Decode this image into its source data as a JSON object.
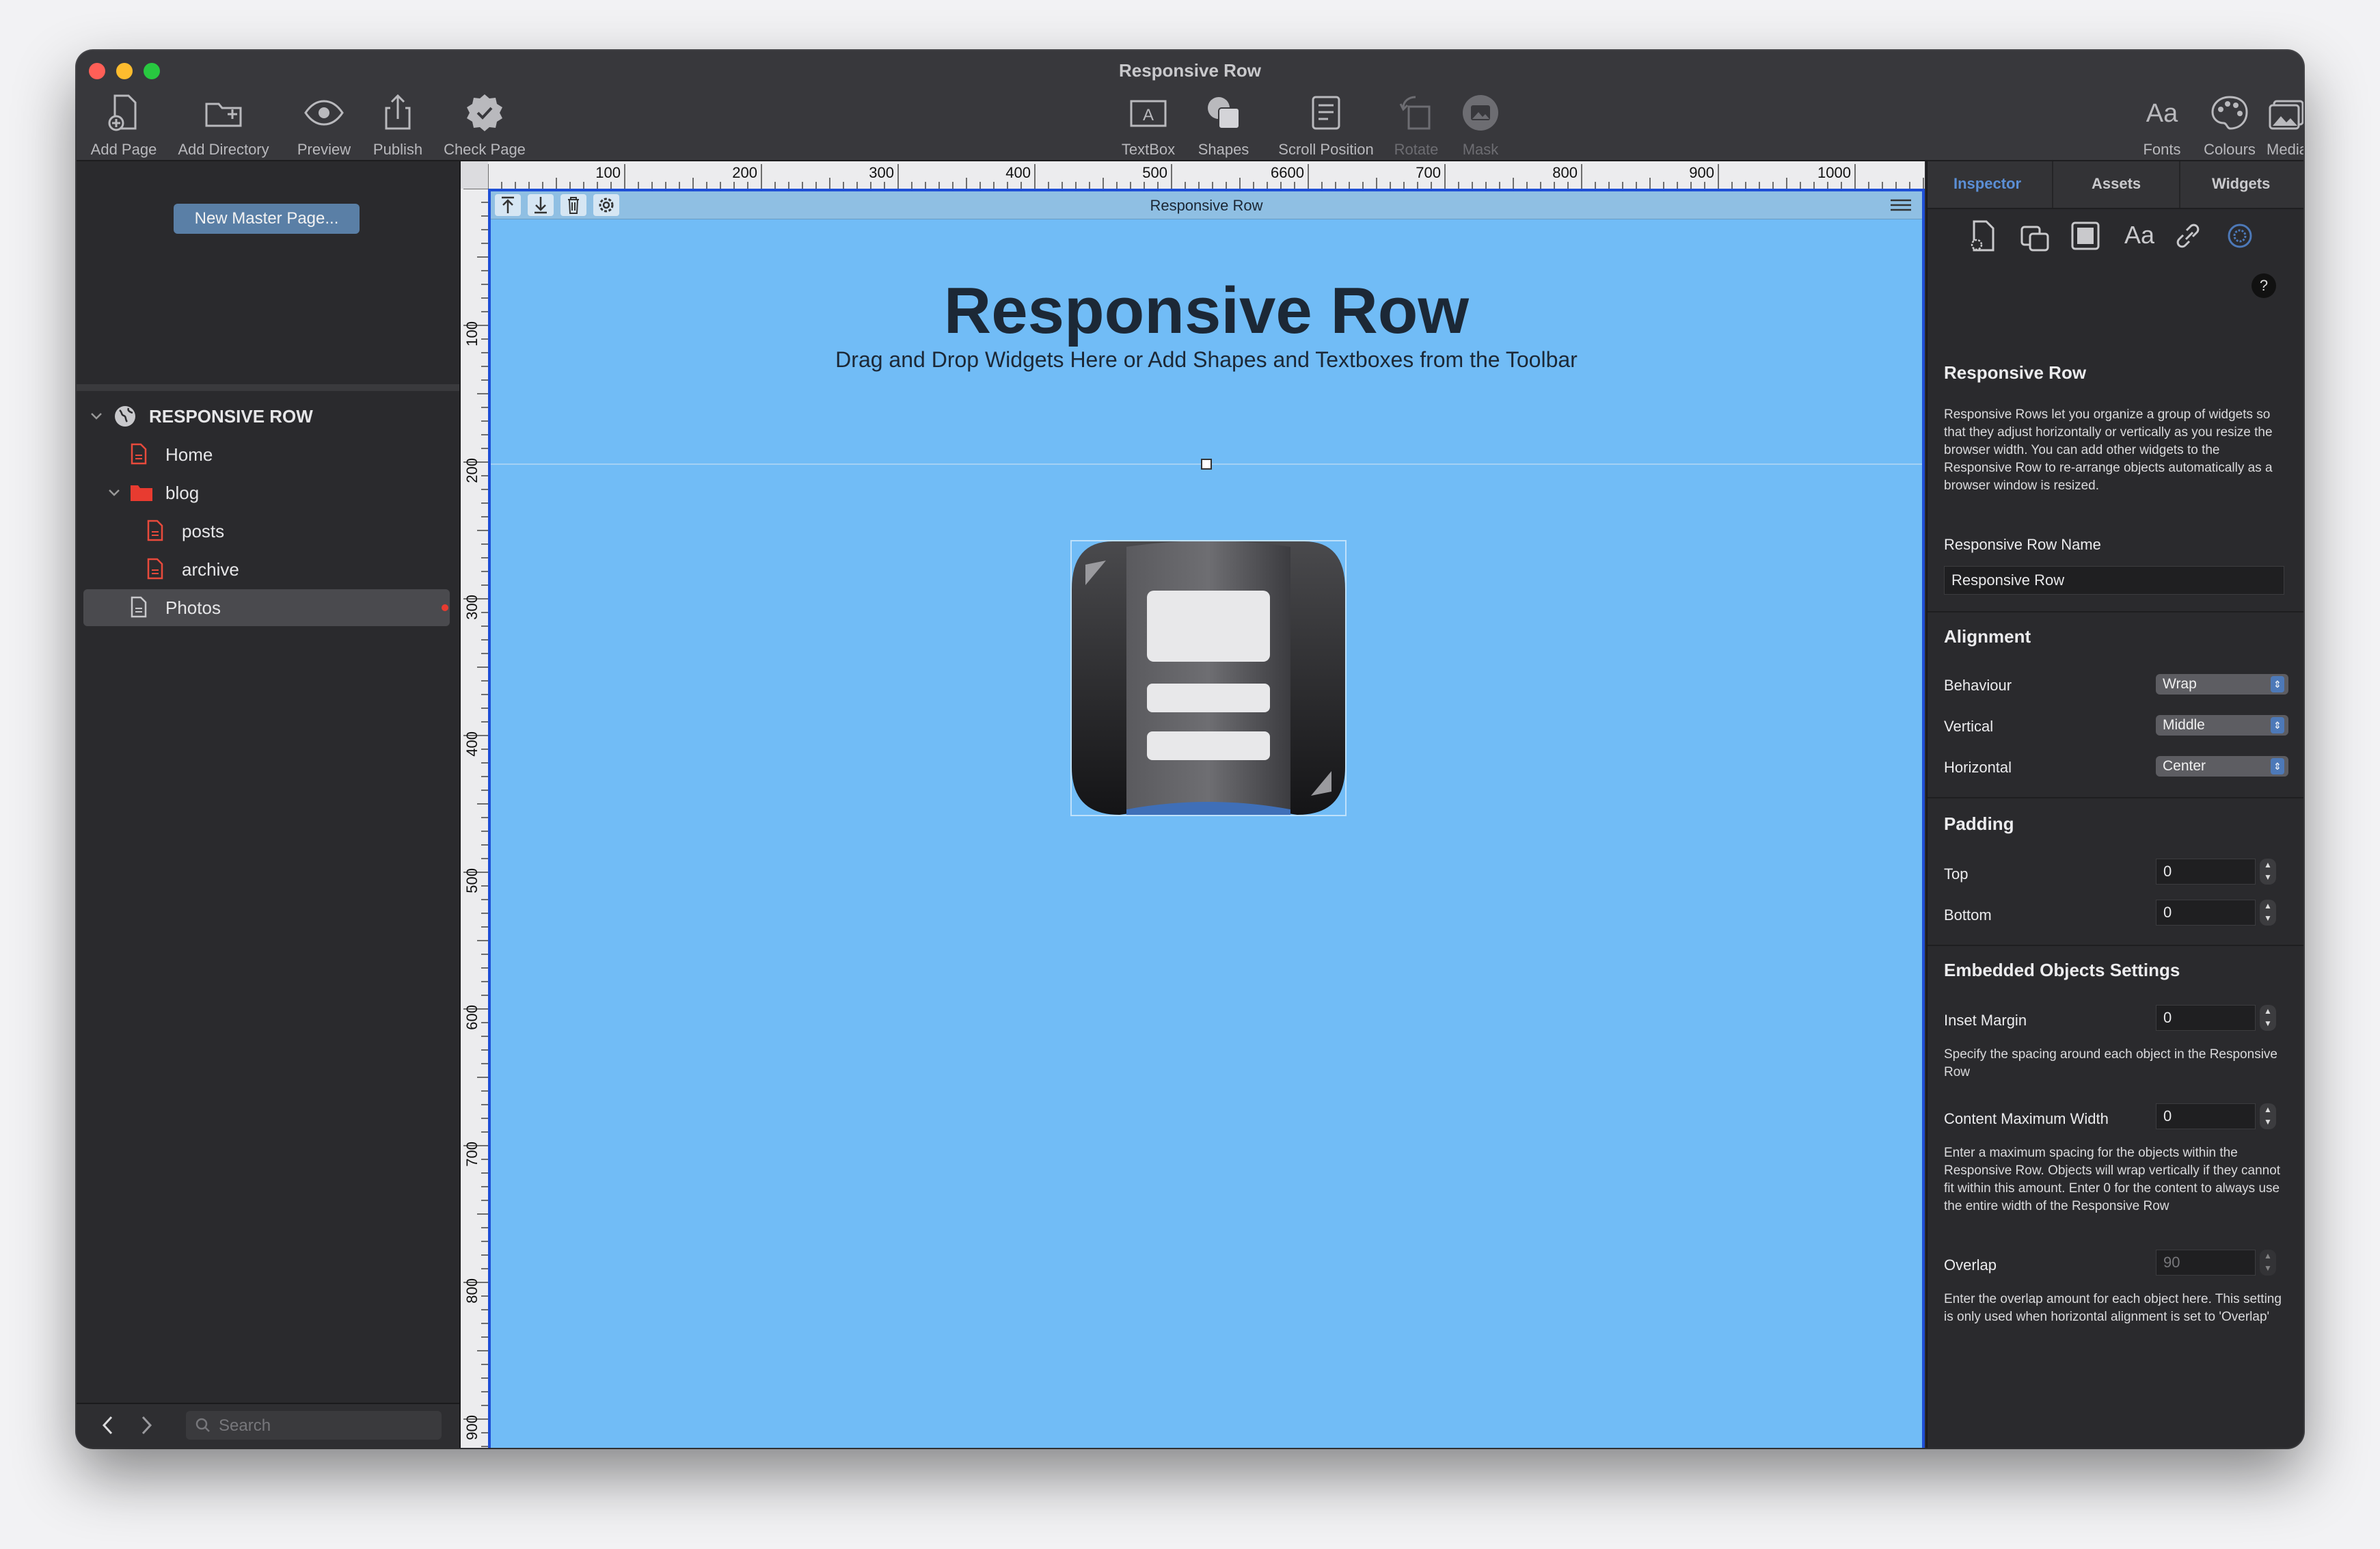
{
  "window": {
    "title": "Responsive Row"
  },
  "toolbar": {
    "add_page": "Add Page",
    "add_directory": "Add Directory",
    "preview": "Preview",
    "publish": "Publish",
    "check_page": "Check Page",
    "textbox": "TextBox",
    "shapes": "Shapes",
    "scroll_position": "Scroll Position",
    "rotate": "Rotate",
    "mask": "Mask",
    "fonts": "Fonts",
    "colours": "Colours",
    "media": "Media"
  },
  "sidebar": {
    "new_master_page": "New Master Page...",
    "site_name": "RESPONSIVE ROW",
    "items": [
      {
        "label": "Home"
      },
      {
        "label": "blog"
      },
      {
        "label": "posts"
      },
      {
        "label": "archive"
      },
      {
        "label": "Photos"
      }
    ],
    "search_placeholder": "Search"
  },
  "rulers": {
    "top": [
      "100",
      "200",
      "300",
      "400",
      "500",
      "6600",
      "700",
      "800",
      "900",
      "1000"
    ],
    "left": [
      "100",
      "200",
      "300",
      "400",
      "500",
      "600",
      "700",
      "800",
      "900"
    ]
  },
  "canvas": {
    "row_header_title": "Responsive Row",
    "hero_title": "Responsive Row",
    "hero_subtitle": "Drag and Drop Widgets Here or Add Shapes and Textboxes from the Toolbar"
  },
  "inspector": {
    "tabs": [
      "Inspector",
      "Assets",
      "Widgets"
    ],
    "help": "?",
    "section_title": "Responsive Row",
    "description": "Responsive Rows let you organize a group of widgets so that they adjust horizontally or vertically as you resize the browser width. You can add other widgets to the Responsive Row to re-arrange objects automatically as a browser window is resized.",
    "name_label": "Responsive Row Name",
    "name_value": "Responsive Row",
    "alignment_heading": "Alignment",
    "behaviour_label": "Behaviour",
    "behaviour_value": "Wrap",
    "vertical_label": "Vertical",
    "vertical_value": "Middle",
    "horizontal_label": "Horizontal",
    "horizontal_value": "Center",
    "padding_heading": "Padding",
    "top_label": "Top",
    "top_value": "0",
    "bottom_label": "Bottom",
    "bottom_value": "0",
    "embedded_heading": "Embedded Objects Settings",
    "inset_label": "Inset Margin",
    "inset_value": "0",
    "inset_help": "Specify the spacing around each object in the Responsive Row",
    "cmw_label": "Content Maximum Width",
    "cmw_value": "0",
    "cmw_help": "Enter a maximum spacing for the objects within the Responsive Row. Objects will wrap vertically if they cannot fit within this amount. Enter 0 for the content to always use the entire width of the Responsive Row",
    "overlap_label": "Overlap",
    "overlap_value": "90",
    "overlap_help": "Enter the overlap amount for each object here. This setting is only used when horizontal alignment is set to 'Overlap'"
  },
  "colors": {
    "canvas_bg": "#71bcf6",
    "selection_border": "#1e4fd6",
    "active_tab": "#5b8fd6"
  }
}
